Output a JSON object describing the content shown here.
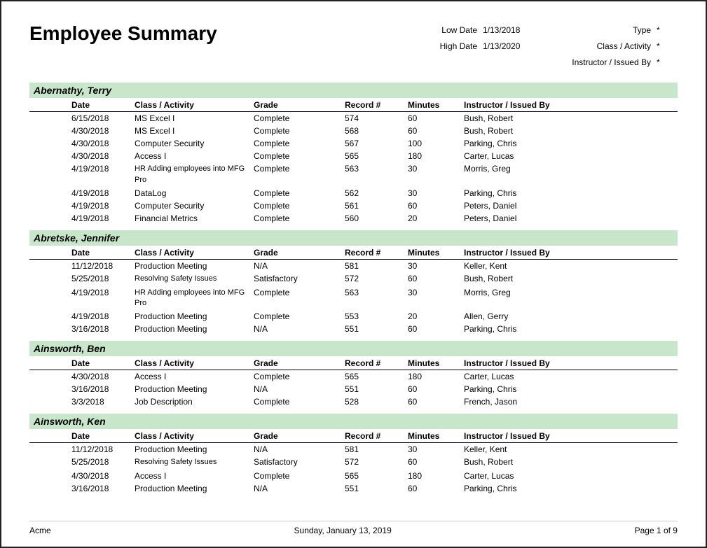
{
  "report": {
    "title": "Employee Summary",
    "meta": {
      "low_date_label": "Low Date",
      "low_date_value": "1/13/2018",
      "high_date_label": "High Date",
      "high_date_value": "1/13/2020",
      "type_label": "Type",
      "type_value": "*",
      "class_label": "Class / Activity",
      "class_value": "*",
      "instructor_label": "Instructor / Issued By",
      "instructor_value": "*"
    },
    "columns": [
      "Date",
      "Class / Activity",
      "Grade",
      "Record #",
      "Minutes",
      "Instructor / Issued By"
    ],
    "employees": [
      {
        "name": "Abernathy, Terry",
        "records": [
          {
            "date": "6/15/2018",
            "class": "MS Excel I",
            "grade": "Complete",
            "record": "574",
            "minutes": "60",
            "instructor": "Bush, Robert"
          },
          {
            "date": "4/30/2018",
            "class": "MS Excel I",
            "grade": "Complete",
            "record": "568",
            "minutes": "60",
            "instructor": "Bush, Robert"
          },
          {
            "date": "4/30/2018",
            "class": "Computer Security",
            "grade": "Complete",
            "record": "567",
            "minutes": "100",
            "instructor": "Parking, Chris"
          },
          {
            "date": "4/30/2018",
            "class": "Access I",
            "grade": "Complete",
            "record": "565",
            "minutes": "180",
            "instructor": "Carter, Lucas"
          },
          {
            "date": "4/19/2018",
            "class": "HR Adding employees into MFG Pro",
            "grade": "Complete",
            "record": "563",
            "minutes": "30",
            "instructor": "Morris, Greg"
          },
          {
            "date": "4/19/2018",
            "class": "DataLog",
            "grade": "Complete",
            "record": "562",
            "minutes": "30",
            "instructor": "Parking, Chris"
          },
          {
            "date": "4/19/2018",
            "class": "Computer Security",
            "grade": "Complete",
            "record": "561",
            "minutes": "60",
            "instructor": "Peters, Daniel"
          },
          {
            "date": "4/19/2018",
            "class": "Financial Metrics",
            "grade": "Complete",
            "record": "560",
            "minutes": "20",
            "instructor": "Peters, Daniel"
          }
        ]
      },
      {
        "name": "Abretske, Jennifer",
        "records": [
          {
            "date": "11/12/2018",
            "class": "Production Meeting",
            "grade": "N/A",
            "record": "581",
            "minutes": "30",
            "instructor": "Keller, Kent"
          },
          {
            "date": "5/25/2018",
            "class": "Resolving Safety Issues",
            "grade": "Satisfactory",
            "record": "572",
            "minutes": "60",
            "instructor": "Bush, Robert"
          },
          {
            "date": "4/19/2018",
            "class": "HR Adding employees into MFG Pro",
            "grade": "Complete",
            "record": "563",
            "minutes": "30",
            "instructor": "Morris, Greg"
          },
          {
            "date": "4/19/2018",
            "class": "Production Meeting",
            "grade": "Complete",
            "record": "553",
            "minutes": "20",
            "instructor": "Allen, Gerry"
          },
          {
            "date": "3/16/2018",
            "class": "Production Meeting",
            "grade": "N/A",
            "record": "551",
            "minutes": "60",
            "instructor": "Parking, Chris"
          }
        ]
      },
      {
        "name": "Ainsworth, Ben",
        "records": [
          {
            "date": "4/30/2018",
            "class": "Access I",
            "grade": "Complete",
            "record": "565",
            "minutes": "180",
            "instructor": "Carter, Lucas"
          },
          {
            "date": "3/16/2018",
            "class": "Production Meeting",
            "grade": "N/A",
            "record": "551",
            "minutes": "60",
            "instructor": "Parking, Chris"
          },
          {
            "date": "3/3/2018",
            "class": "Job Description",
            "grade": "Complete",
            "record": "528",
            "minutes": "60",
            "instructor": "French, Jason"
          }
        ]
      },
      {
        "name": "Ainsworth, Ken",
        "records": [
          {
            "date": "11/12/2018",
            "class": "Production Meeting",
            "grade": "N/A",
            "record": "581",
            "minutes": "30",
            "instructor": "Keller, Kent"
          },
          {
            "date": "5/25/2018",
            "class": "Resolving Safety Issues",
            "grade": "Satisfactory",
            "record": "572",
            "minutes": "60",
            "instructor": "Bush, Robert"
          },
          {
            "date": "4/30/2018",
            "class": "Access I",
            "grade": "Complete",
            "record": "565",
            "minutes": "180",
            "instructor": "Carter, Lucas"
          },
          {
            "date": "3/16/2018",
            "class": "Production Meeting",
            "grade": "N/A",
            "record": "551",
            "minutes": "60",
            "instructor": "Parking, Chris"
          }
        ]
      }
    ],
    "footer": {
      "company": "Acme",
      "date": "Sunday, January 13, 2019",
      "page": "Page 1 of 9"
    }
  }
}
